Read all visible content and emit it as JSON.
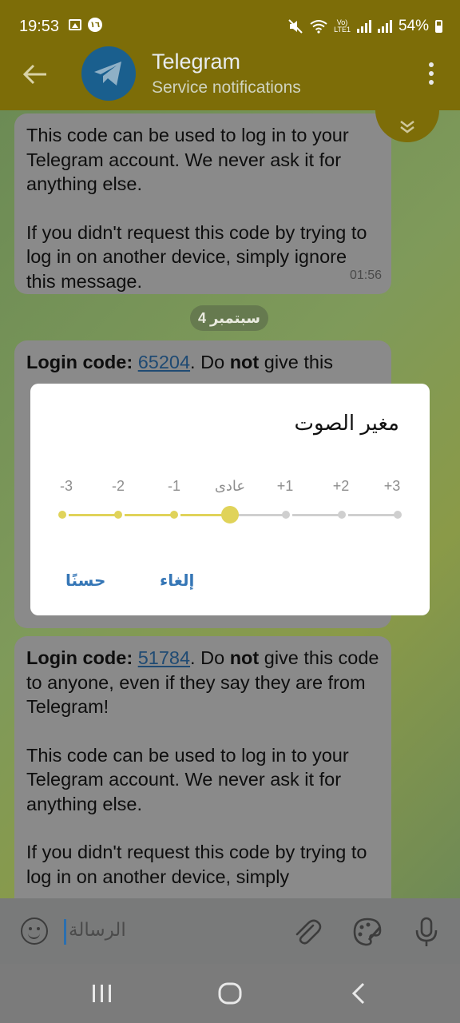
{
  "status_bar": {
    "time": "19:53",
    "badge": "١٦",
    "network": "LTE1",
    "volte": "Vo)",
    "battery": "54%"
  },
  "header": {
    "title": "Telegram",
    "subtitle": "Service notifications",
    "colors": {
      "bar": "#7d6d08",
      "avatar": "#1a5f8e"
    }
  },
  "messages": [
    {
      "lines_a": "This code can be used to log in to your Telegram account. We never ask it for anything else.",
      "lines_b": "If you didn't request this code by trying to log in on another device, simply ignore this message.",
      "time": "01:56"
    },
    {
      "prefix": "Login code: ",
      "code": "65204",
      "mid_1": ". Do ",
      "bold_word": "not",
      "mid_2": " give this"
    },
    {
      "prefix": "Login code: ",
      "code": "51784",
      "mid_1": ". Do ",
      "bold_word": "not",
      "mid_2": " give this code to anyone, even if they say they are from Telegram!",
      "lines_a": "This code can be used to log in to your Telegram account. We never ask it for anything else.",
      "lines_b": "If you didn't request this code by trying to log in on another device, simply"
    }
  ],
  "date_separator": "4 سبتمبر",
  "dialog": {
    "title": "مغير الصوت",
    "ticks": [
      "-3",
      "-2",
      "-1",
      "عادى",
      "+1",
      "+2",
      "+3"
    ],
    "selected_index": 3,
    "ok_label": "حسنًا",
    "cancel_label": "إلغاء",
    "colors": {
      "active": "#e0d35a",
      "inactive": "#cfcfcf",
      "button": "#3576b6"
    }
  },
  "input": {
    "placeholder": "الرسالة"
  }
}
